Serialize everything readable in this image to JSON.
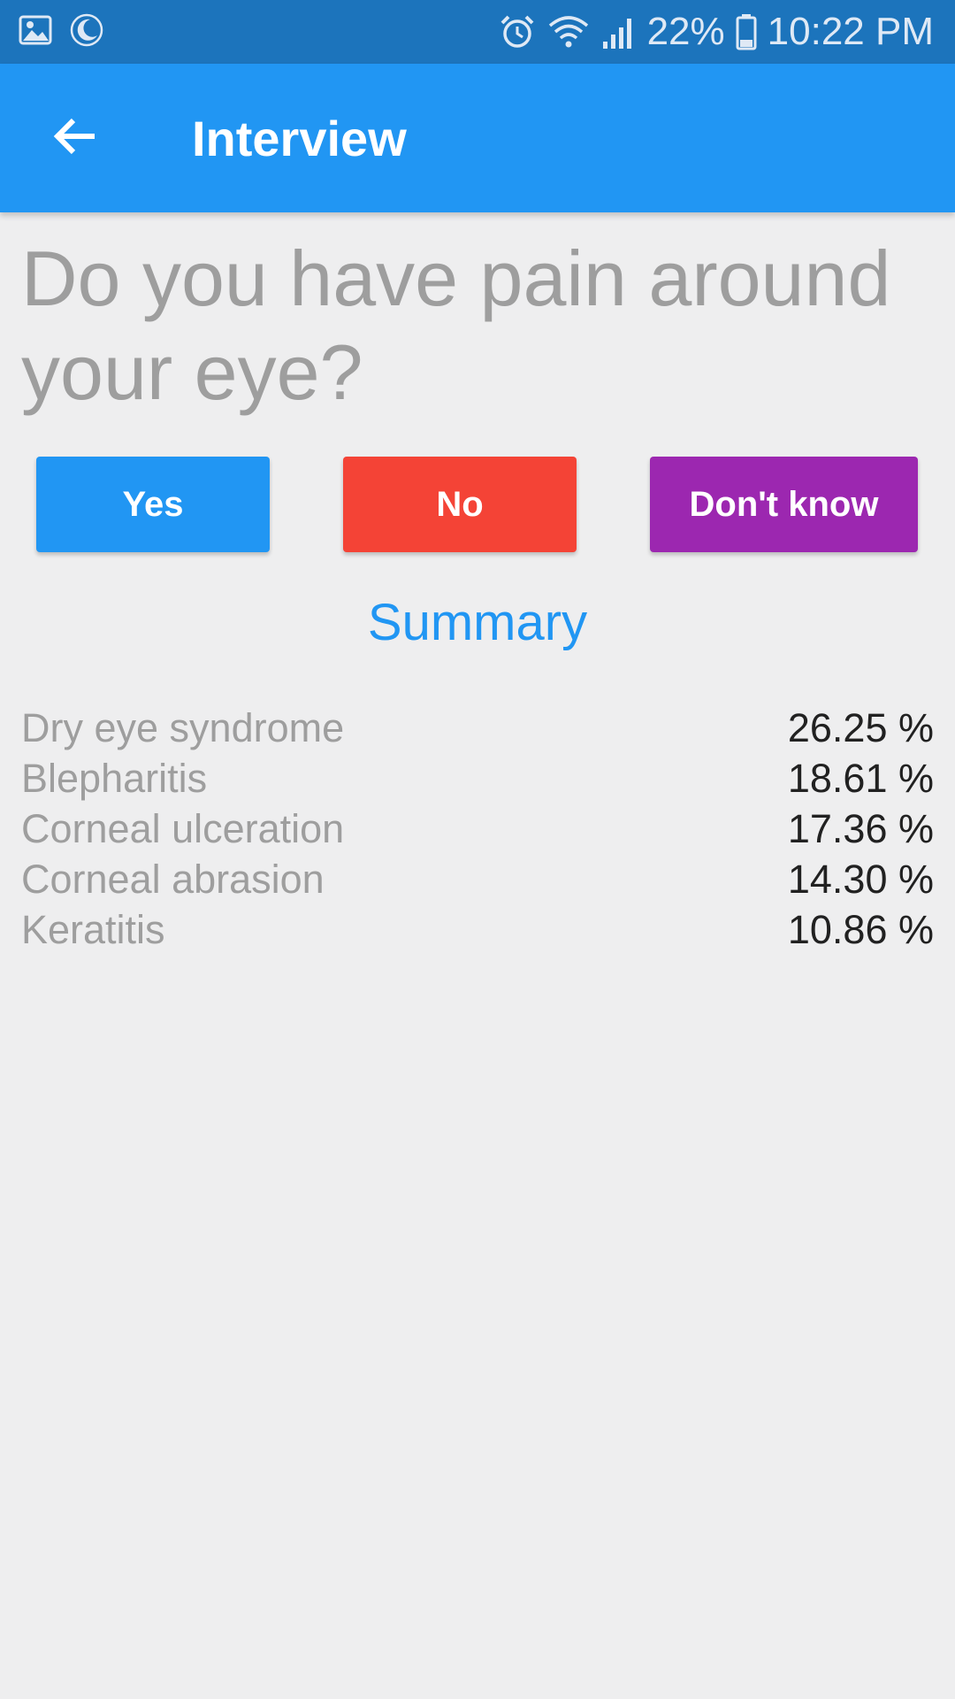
{
  "status_bar": {
    "battery_pct": "22%",
    "time": "10:22 PM",
    "icons": [
      "gallery-icon",
      "moon-icon",
      "alarm-icon",
      "wifi-icon",
      "signal-icon",
      "battery-icon"
    ]
  },
  "app_bar": {
    "title": "Interview",
    "back_icon": "arrow-left-icon"
  },
  "question": {
    "text": "Do you have pain around your eye?"
  },
  "answers": {
    "yes": "Yes",
    "no": "No",
    "dont_know": "Don't know"
  },
  "summary": {
    "title": "Summary",
    "items": [
      {
        "name": "Dry eye syndrome",
        "pct": "26.25 %"
      },
      {
        "name": "Blepharitis",
        "pct": "18.61 %"
      },
      {
        "name": "Corneal ulceration",
        "pct": "17.36 %"
      },
      {
        "name": "Corneal abrasion",
        "pct": "14.30 %"
      },
      {
        "name": "Keratitis",
        "pct": "10.86 %"
      }
    ]
  },
  "colors": {
    "status_bar": "#1c74bc",
    "app_bar": "#2196f3",
    "yes": "#2196f3",
    "no": "#f44336",
    "dont_know": "#9c27b0",
    "summary_title": "#2196f3",
    "background": "#eeeeef"
  }
}
